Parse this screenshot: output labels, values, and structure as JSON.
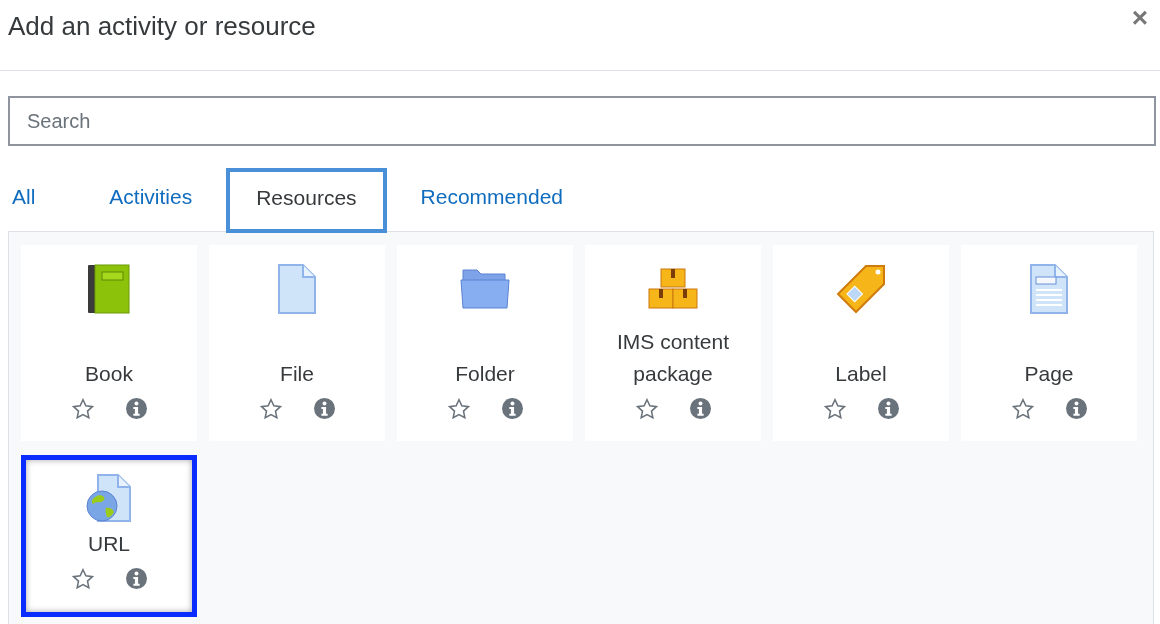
{
  "dialog": {
    "title": "Add an activity or resource",
    "close": "×"
  },
  "search": {
    "placeholder": "Search"
  },
  "tabs": [
    {
      "label": "All",
      "selected": false
    },
    {
      "label": "Activities",
      "selected": false
    },
    {
      "label": "Resources",
      "selected": true
    },
    {
      "label": "Recommended",
      "selected": false
    }
  ],
  "items": [
    {
      "kind": "book",
      "name": "Book",
      "starred": false,
      "selected": false
    },
    {
      "kind": "file",
      "name": "File",
      "starred": false,
      "selected": false
    },
    {
      "kind": "folder",
      "name": "Folder",
      "starred": false,
      "selected": false
    },
    {
      "kind": "package",
      "name": "IMS content package",
      "starred": false,
      "selected": false
    },
    {
      "kind": "label",
      "name": "Label",
      "starred": false,
      "selected": false
    },
    {
      "kind": "page",
      "name": "Page",
      "starred": false,
      "selected": false
    },
    {
      "kind": "url",
      "name": "URL",
      "starred": false,
      "selected": true
    }
  ]
}
